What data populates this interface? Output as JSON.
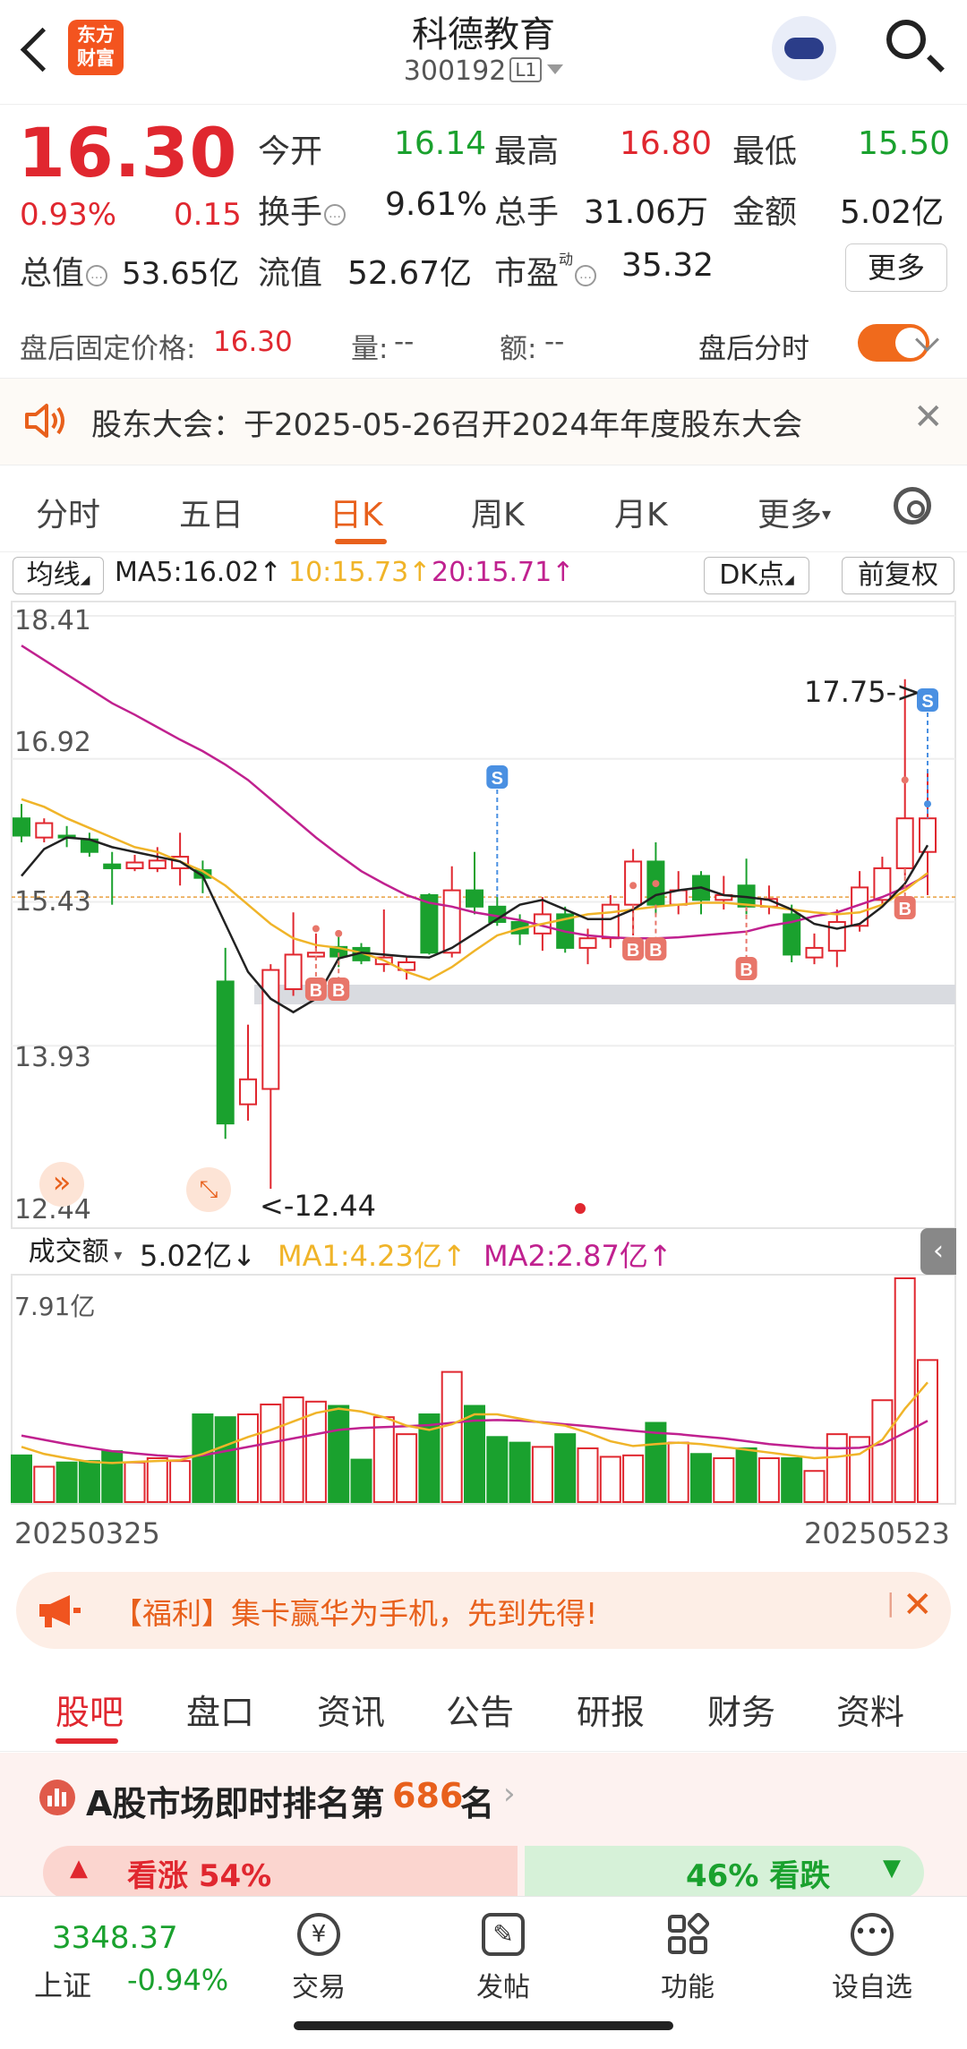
{
  "header": {
    "logo_text_line1": "东方",
    "logo_text_line2": "财富",
    "title": "科德教育",
    "code": "300192",
    "level": "L1"
  },
  "quote": {
    "price": "16.30",
    "change_pct": "0.93%",
    "change": "0.15",
    "open_label": "今开",
    "open": "16.14",
    "high_label": "最高",
    "high": "16.80",
    "low_label": "最低",
    "low": "15.50",
    "turnover_label": "换手",
    "turnover": "9.61%",
    "volume_label": "总手",
    "volume": "31.06万",
    "amount_label": "金额",
    "amount": "5.02亿",
    "mktcap_label": "总值",
    "mktcap": "53.65亿",
    "float_label": "流值",
    "float": "52.67亿",
    "pe_label": "市盈",
    "pe_sup": "动",
    "pe": "35.32",
    "more_label": "更多"
  },
  "after_hours": {
    "price_label": "盘后固定价格:",
    "price": "16.30",
    "vol_label": "量:",
    "vol": "--",
    "amt_label": "额:",
    "amt": "--",
    "timeshare_label": "盘后分时"
  },
  "notice": {
    "text": "股东大会：于2025-05-26召开2024年年度股东大会"
  },
  "chart_tabs": [
    "分时",
    "五日",
    "日K",
    "周K",
    "月K",
    "更多"
  ],
  "ma_row": {
    "selector": "均线",
    "ma5": "MA5:16.02↑",
    "ma10": "10:15.73↑",
    "ma20": "20:15.71↑",
    "dk": "DK点",
    "adjust": "前复权"
  },
  "price_axis": [
    "18.41",
    "16.92",
    "15.43",
    "13.93",
    "12.44"
  ],
  "annotations": {
    "high_mark": "17.75->",
    "low_mark": "<-12.44"
  },
  "volume_row": {
    "selector": "成交额",
    "value": "5.02亿↓",
    "ma1": "MA1:4.23亿↑",
    "ma2": "MA2:2.87亿↑",
    "axis_max": "7.91亿"
  },
  "date_axis": {
    "start": "20250325",
    "end": "20250523"
  },
  "chart_data": {
    "type": "candlestick",
    "ylim": [
      12.44,
      18.41
    ],
    "candles": [
      {
        "o": 16.3,
        "c": 16.12,
        "h": 16.45,
        "l": 16.05
      },
      {
        "o": 16.1,
        "c": 16.25,
        "h": 16.3,
        "l": 16.05
      },
      {
        "o": 16.12,
        "c": 16.1,
        "h": 16.22,
        "l": 16.0
      },
      {
        "o": 16.08,
        "c": 15.95,
        "h": 16.15,
        "l": 15.9
      },
      {
        "o": 15.82,
        "c": 15.78,
        "h": 15.95,
        "l": 15.4
      },
      {
        "o": 15.78,
        "c": 15.84,
        "h": 15.92,
        "l": 15.75
      },
      {
        "o": 15.78,
        "c": 15.86,
        "h": 16.0,
        "l": 15.74
      },
      {
        "o": 15.78,
        "c": 15.9,
        "h": 16.15,
        "l": 15.6
      },
      {
        "o": 15.76,
        "c": 15.68,
        "h": 15.86,
        "l": 15.52
      },
      {
        "o": 14.6,
        "c": 13.12,
        "h": 14.95,
        "l": 12.96
      },
      {
        "o": 13.32,
        "c": 13.58,
        "h": 14.15,
        "l": 13.15
      },
      {
        "o": 13.48,
        "c": 14.72,
        "h": 14.78,
        "l": 12.44
      },
      {
        "o": 14.52,
        "c": 14.88,
        "h": 15.32,
        "l": 14.45
      },
      {
        "o": 14.86,
        "c": 14.9,
        "h": 15.1,
        "l": 14.82
      },
      {
        "o": 14.96,
        "c": 14.86,
        "h": 15.08,
        "l": 14.75
      },
      {
        "o": 14.95,
        "c": 14.82,
        "h": 15.0,
        "l": 14.78
      },
      {
        "o": 14.78,
        "c": 14.85,
        "h": 15.35,
        "l": 14.7
      },
      {
        "o": 14.72,
        "c": 14.8,
        "h": 14.85,
        "l": 14.62
      },
      {
        "o": 15.5,
        "c": 14.9,
        "h": 15.52,
        "l": 14.88
      },
      {
        "o": 14.9,
        "c": 15.55,
        "h": 15.8,
        "l": 14.85
      },
      {
        "o": 15.55,
        "c": 15.38,
        "h": 15.95,
        "l": 15.3
      },
      {
        "o": 15.38,
        "c": 15.22,
        "h": 15.48,
        "l": 15.18
      },
      {
        "o": 15.22,
        "c": 15.1,
        "h": 15.3,
        "l": 14.98
      },
      {
        "o": 15.1,
        "c": 15.3,
        "h": 15.48,
        "l": 14.92
      },
      {
        "o": 15.3,
        "c": 14.95,
        "h": 15.38,
        "l": 14.9
      },
      {
        "o": 14.95,
        "c": 15.05,
        "h": 15.15,
        "l": 14.78
      },
      {
        "o": 15.05,
        "c": 15.4,
        "h": 15.5,
        "l": 14.95
      },
      {
        "o": 15.4,
        "c": 15.85,
        "h": 15.98,
        "l": 15.08
      },
      {
        "o": 15.85,
        "c": 15.4,
        "h": 16.05,
        "l": 15.3
      },
      {
        "o": 15.4,
        "c": 15.55,
        "h": 15.75,
        "l": 15.3
      },
      {
        "o": 15.7,
        "c": 15.45,
        "h": 15.75,
        "l": 15.3
      },
      {
        "o": 15.45,
        "c": 15.5,
        "h": 15.7,
        "l": 15.35
      },
      {
        "o": 15.6,
        "c": 15.38,
        "h": 15.88,
        "l": 15.3
      },
      {
        "o": 15.38,
        "c": 15.46,
        "h": 15.6,
        "l": 15.3
      },
      {
        "o": 15.3,
        "c": 14.88,
        "h": 15.4,
        "l": 14.8
      },
      {
        "o": 14.85,
        "c": 14.95,
        "h": 15.1,
        "l": 14.78
      },
      {
        "o": 14.92,
        "c": 15.22,
        "h": 15.35,
        "l": 14.75
      },
      {
        "o": 15.18,
        "c": 15.58,
        "h": 15.75,
        "l": 15.12
      },
      {
        "o": 15.45,
        "c": 15.78,
        "h": 15.9,
        "l": 15.4
      },
      {
        "o": 15.78,
        "c": 16.3,
        "h": 17.75,
        "l": 15.7
      },
      {
        "o": 15.95,
        "c": 16.3,
        "h": 16.8,
        "l": 15.5
      }
    ],
    "ma5": [
      15.7,
      15.98,
      16.1,
      16.08,
      16.0,
      15.95,
      15.9,
      15.85,
      15.7,
      15.2,
      14.7,
      14.42,
      14.28,
      14.42,
      14.84,
      14.9,
      14.88,
      14.86,
      14.85,
      14.95,
      15.1,
      15.25,
      15.4,
      15.45,
      15.35,
      15.25,
      15.25,
      15.35,
      15.5,
      15.55,
      15.58,
      15.5,
      15.48,
      15.45,
      15.35,
      15.2,
      15.15,
      15.2,
      15.38,
      15.62,
      16.02
    ],
    "ma10": [
      16.5,
      16.42,
      16.3,
      16.2,
      16.1,
      16.0,
      15.95,
      15.85,
      15.75,
      15.6,
      15.4,
      15.2,
      15.05,
      14.98,
      14.95,
      14.9,
      14.82,
      14.7,
      14.62,
      14.75,
      14.92,
      15.08,
      15.15,
      15.2,
      15.25,
      15.3,
      15.32,
      15.35,
      15.38,
      15.4,
      15.42,
      15.42,
      15.4,
      15.38,
      15.35,
      15.32,
      15.3,
      15.32,
      15.4,
      15.55,
      15.73
    ],
    "ma20": [
      18.1,
      17.95,
      17.8,
      17.65,
      17.5,
      17.38,
      17.25,
      17.12,
      17.0,
      16.86,
      16.7,
      16.5,
      16.3,
      16.1,
      15.92,
      15.75,
      15.62,
      15.5,
      15.42,
      15.38,
      15.32,
      15.28,
      15.24,
      15.18,
      15.12,
      15.08,
      15.06,
      15.05,
      15.05,
      15.06,
      15.08,
      15.1,
      15.12,
      15.18,
      15.22,
      15.28,
      15.32,
      15.4,
      15.48,
      15.58,
      15.71
    ],
    "volume_max": 7.91,
    "volume": [
      1.65,
      1.25,
      1.4,
      1.45,
      1.8,
      1.4,
      1.55,
      1.45,
      3.1,
      3.0,
      3.1,
      3.45,
      3.7,
      3.55,
      3.4,
      1.5,
      3.0,
      2.4,
      3.1,
      4.6,
      3.4,
      2.3,
      2.1,
      1.95,
      2.4,
      1.9,
      1.6,
      1.65,
      2.8,
      2.1,
      1.7,
      1.55,
      1.9,
      1.55,
      1.55,
      1.1,
      2.4,
      2.3,
      3.6,
      7.91,
      5.02
    ],
    "vol_ma1": [
      1.95,
      1.7,
      1.55,
      1.42,
      1.38,
      1.42,
      1.45,
      1.48,
      1.7,
      2.0,
      2.3,
      2.55,
      2.85,
      3.15,
      3.3,
      3.2,
      3.0,
      2.7,
      2.55,
      2.75,
      3.1,
      3.1,
      2.95,
      2.8,
      2.7,
      2.45,
      2.15,
      1.98,
      2.05,
      2.1,
      2.05,
      1.95,
      1.85,
      1.75,
      1.65,
      1.55,
      1.6,
      1.7,
      2.2,
      3.3,
      4.23
    ],
    "vol_ma2": [
      2.35,
      2.2,
      2.05,
      1.92,
      1.8,
      1.72,
      1.65,
      1.6,
      1.65,
      1.8,
      1.95,
      2.1,
      2.25,
      2.4,
      2.55,
      2.62,
      2.65,
      2.68,
      2.72,
      2.8,
      2.88,
      2.9,
      2.88,
      2.82,
      2.75,
      2.68,
      2.6,
      2.52,
      2.45,
      2.4,
      2.32,
      2.25,
      2.15,
      2.05,
      1.98,
      1.92,
      1.9,
      1.92,
      2.05,
      2.45,
      2.87
    ]
  },
  "volume_rows": {},
  "banner": {
    "text": "【福利】集卡赢华为手机，先到先得!"
  },
  "sub_tabs": [
    "股吧",
    "盘口",
    "资讯",
    "公告",
    "研报",
    "财务",
    "资料"
  ],
  "rank": {
    "prefix": "A股市场即时排名第",
    "rank": "686",
    "suffix": "名",
    "bull": "看涨 54%",
    "bear": "46% 看跌"
  },
  "bottom_nav": {
    "index_value": "3348.37",
    "index_name": "上证",
    "index_change": "-0.94%",
    "items": [
      "交易",
      "发帖",
      "功能",
      "设自选"
    ]
  },
  "colors": {
    "up": "#e0272f",
    "down": "#1aa12e",
    "ma5": "#222222",
    "ma10": "#f0b429",
    "ma20": "#c0218f",
    "accent": "#e8601c"
  }
}
